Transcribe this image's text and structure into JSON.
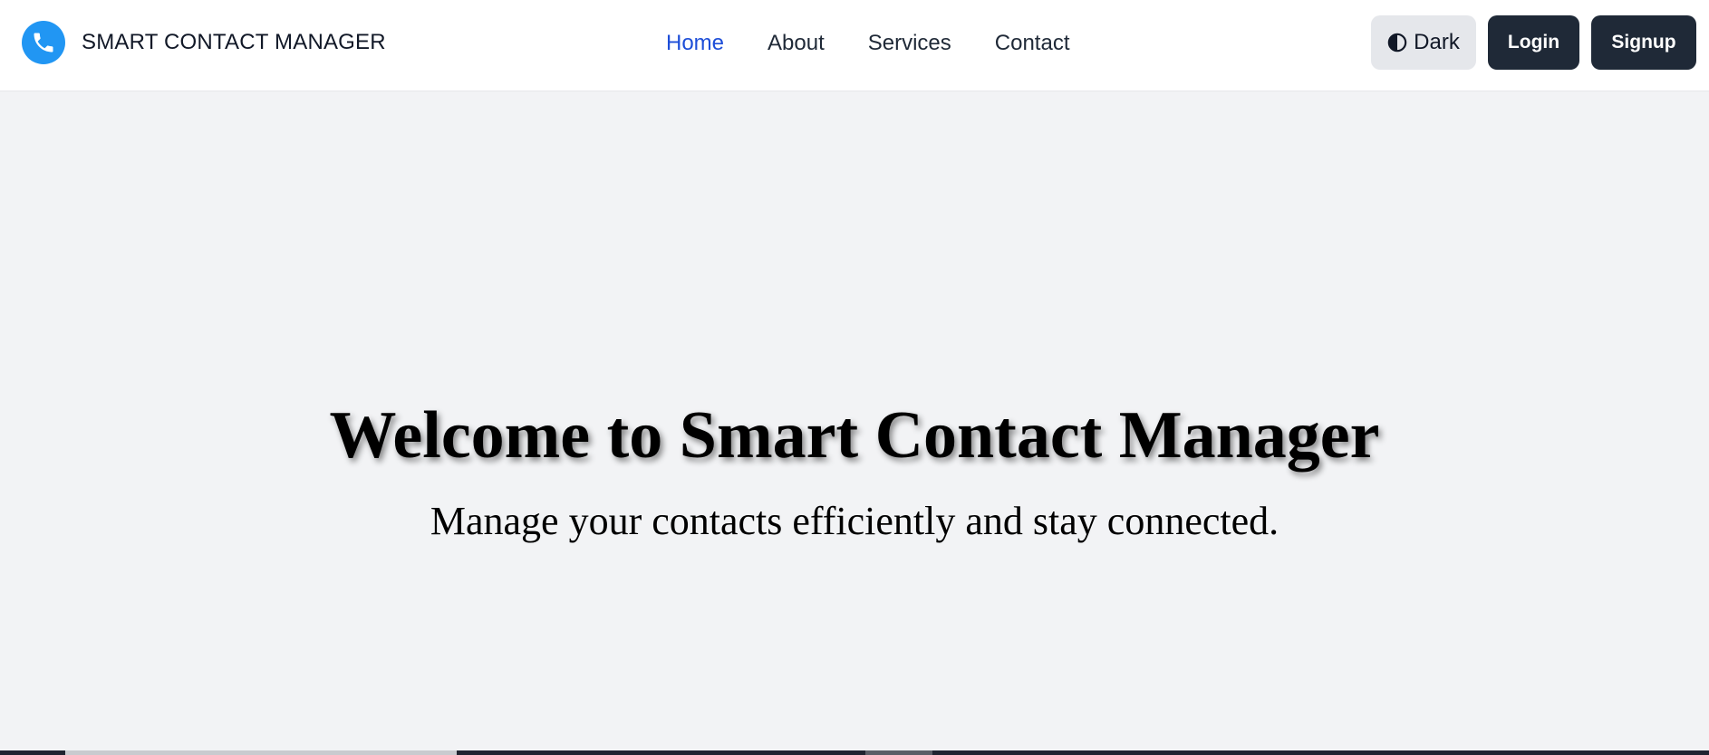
{
  "app": {
    "brand_name": "SMART CONTACT MANAGER",
    "logo_icon": "phone-icon",
    "accent_color": "#2196f3"
  },
  "nav": {
    "items": [
      {
        "label": "Home",
        "active": true
      },
      {
        "label": "About",
        "active": false
      },
      {
        "label": "Services",
        "active": false
      },
      {
        "label": "Contact",
        "active": false
      }
    ],
    "active_color": "#1d4ed8"
  },
  "actions": {
    "theme_toggle_label": "Dark",
    "theme_icon": "contrast-icon",
    "login_label": "Login",
    "signup_label": "Signup",
    "button_color": "#1f2937"
  },
  "hero": {
    "title": "Welcome to Smart Contact Manager",
    "subtitle": "Manage your contacts efficiently and stay connected."
  }
}
